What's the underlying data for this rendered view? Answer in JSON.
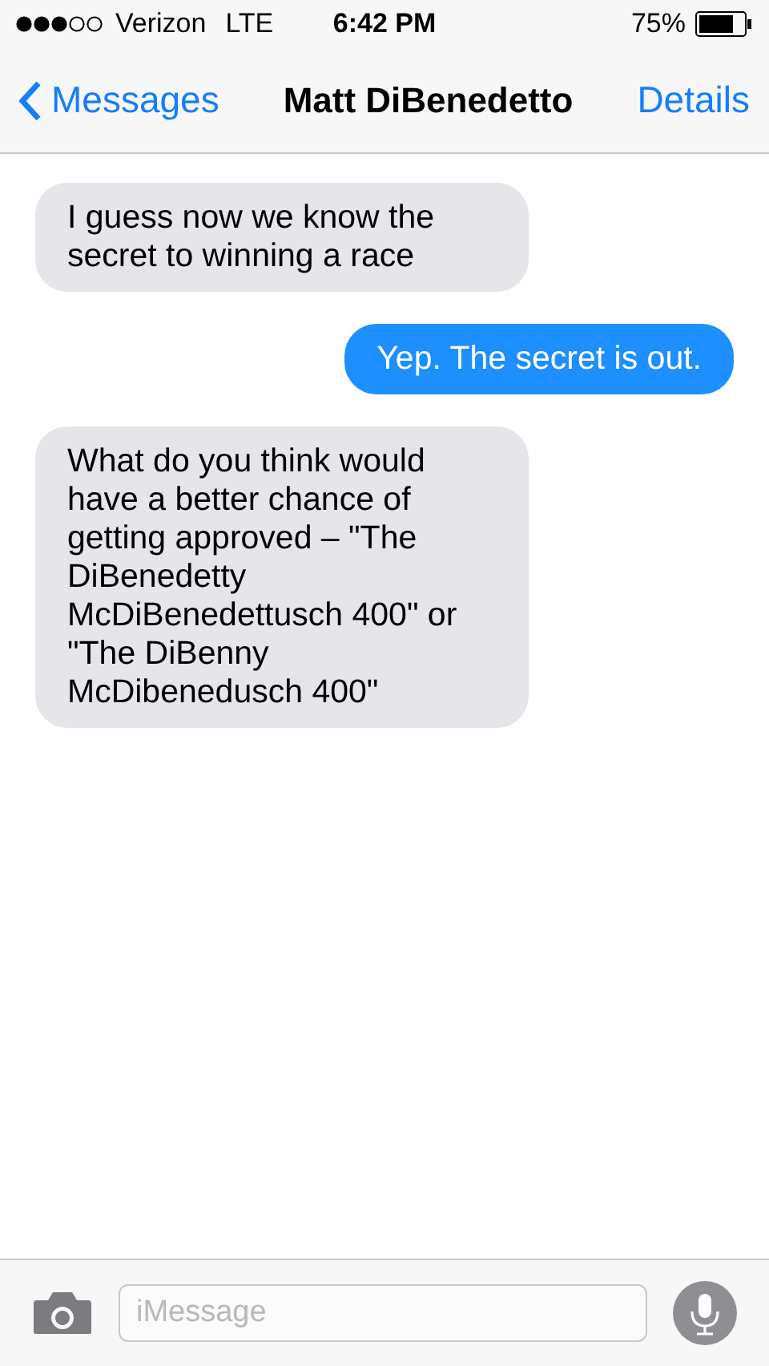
{
  "status_bar": {
    "carrier": "Verizon",
    "network": "LTE",
    "time": "6:42 PM",
    "battery": "75%"
  },
  "nav": {
    "back": "Messages",
    "title": "Matt DiBenedetto",
    "action": "Details"
  },
  "messages": [
    {
      "kind": "received",
      "text": "I guess now we know the secret to winning a race"
    },
    {
      "kind": "sent",
      "text": "Yep. The secret is out."
    },
    {
      "kind": "received",
      "text": "What do you think would have a better chance of getting approved – \"The DiBenedetty McDiBenedettusch 400\" or \"The DiBenny McDibenedusch 400\""
    }
  ],
  "composer": {
    "placeholder": "iMessage"
  }
}
